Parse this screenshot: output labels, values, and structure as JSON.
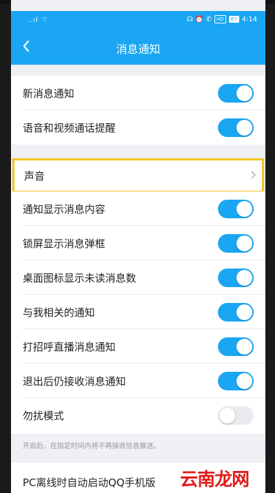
{
  "status_bar": {
    "signal": "..ıl ⌔",
    "hd_badge": "HD",
    "icons": "☊ ⏰ ✆",
    "battery": "87",
    "time": "4:14"
  },
  "header": {
    "title": "消息通知"
  },
  "group1": [
    {
      "label": "新消息通知",
      "on": true
    },
    {
      "label": "语音和视频通话提醒",
      "on": true
    }
  ],
  "sound": {
    "label": "声音"
  },
  "group2": [
    {
      "label": "通知显示消息内容",
      "on": true
    },
    {
      "label": "锁屏显示消息弹框",
      "on": true
    },
    {
      "label": "桌面图标显示未读消息数",
      "on": true
    },
    {
      "label": "与我相关的通知",
      "on": true
    },
    {
      "label": "打招呼直播消息通知",
      "on": true
    },
    {
      "label": "退出后仍接收消息通知",
      "on": true
    },
    {
      "label": "勿扰模式",
      "on": false
    }
  ],
  "note": "开启后，在指定时间内将不再接收信息推送。",
  "last_item": "PC离线时自动启动QQ手机版",
  "watermark": "云南龙网",
  "colors": {
    "accent": "#1aa6f2",
    "highlight": "#f5c21a"
  }
}
